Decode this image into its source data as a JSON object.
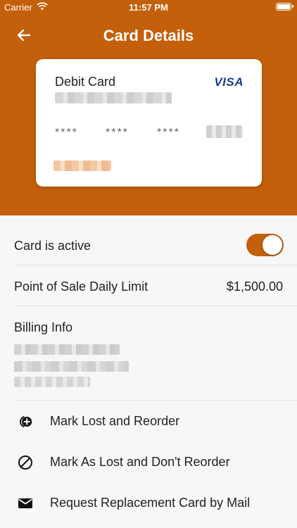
{
  "status_bar": {
    "carrier": "Carrier",
    "time": "11:57 PM"
  },
  "nav": {
    "title": "Card Details"
  },
  "card": {
    "type_label": "Debit Card",
    "network": "VISA",
    "masked_group_1": "****",
    "masked_group_2": "****",
    "masked_group_3": "****"
  },
  "settings": {
    "active_label": "Card is active",
    "active_on": true,
    "limit_label": "Point of Sale Daily Limit",
    "limit_value": "$1,500.00",
    "billing_label": "Billing Info"
  },
  "actions": [
    {
      "label": "Mark Lost and Reorder",
      "icon": "add-circle-icon"
    },
    {
      "label": "Mark As Lost and Don't Reorder",
      "icon": "block-icon"
    },
    {
      "label": "Request Replacement Card by Mail",
      "icon": "mail-icon"
    }
  ],
  "colors": {
    "brand": "#c45f0c",
    "visa": "#1a3d8f",
    "background": "#f7f7f7"
  }
}
